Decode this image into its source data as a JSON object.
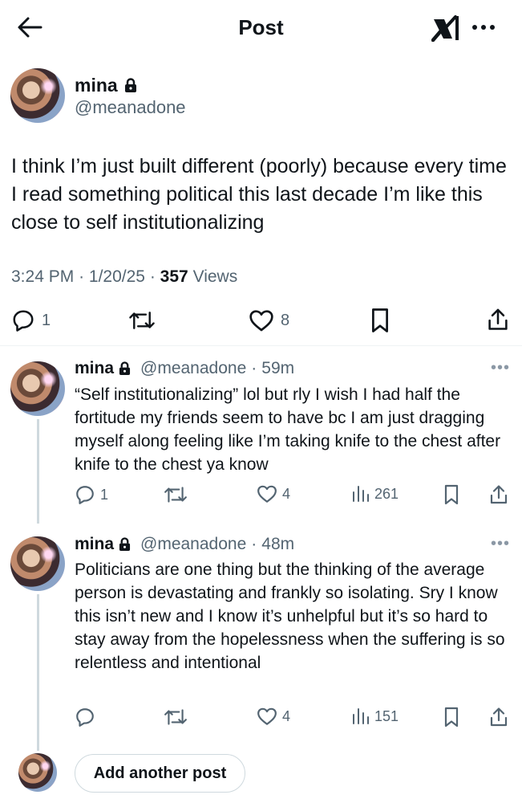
{
  "header": {
    "title": "Post",
    "back_icon": "back-arrow-icon",
    "logo_icon": "x-grok-logo-icon",
    "more_icon": "more-horizontal-icon"
  },
  "main_post": {
    "author_name": "mina",
    "author_handle": "@meanadone",
    "locked_icon": "lock-icon",
    "text": "I think I’m just built different (poorly) because every time I read something political this last decade I’m like this close to self institutionalizing",
    "time": "3:24 PM",
    "date": "1/20/25",
    "views_count": "357",
    "views_label": "Views",
    "meta_sep": "·",
    "actions": {
      "replies": "1",
      "reposts": "",
      "likes": "8"
    }
  },
  "replies": [
    {
      "author_name": "mina",
      "author_handle": "@meanadone",
      "age": "59m",
      "text": "“Self institutionalizing” lol but rly I wish I had half the fortitude my friends seem to have bc I am just dragging myself along feeling like I’m taking knife to the chest after knife to the chest ya know",
      "replies": "1",
      "reposts": "",
      "likes": "4",
      "views": "261",
      "more": "•••"
    },
    {
      "author_name": "mina",
      "author_handle": "@meanadone",
      "age": "48m",
      "text": "Politicians are one thing but the thinking of the average person is devastating and frankly so isolating. Sry I know this isn’t new and I know it’s unhelpful but it’s so hard to stay away from the hopelessness when the suffering is so relentless and intentional",
      "replies": "",
      "reposts": "",
      "likes": "4",
      "views": "151",
      "more": "•••"
    }
  ],
  "compose": {
    "button_label": "Add another post"
  },
  "colors": {
    "text": "#0f1419",
    "secondary": "#536471",
    "border": "#cfd9de",
    "divider": "#eff3f4"
  }
}
